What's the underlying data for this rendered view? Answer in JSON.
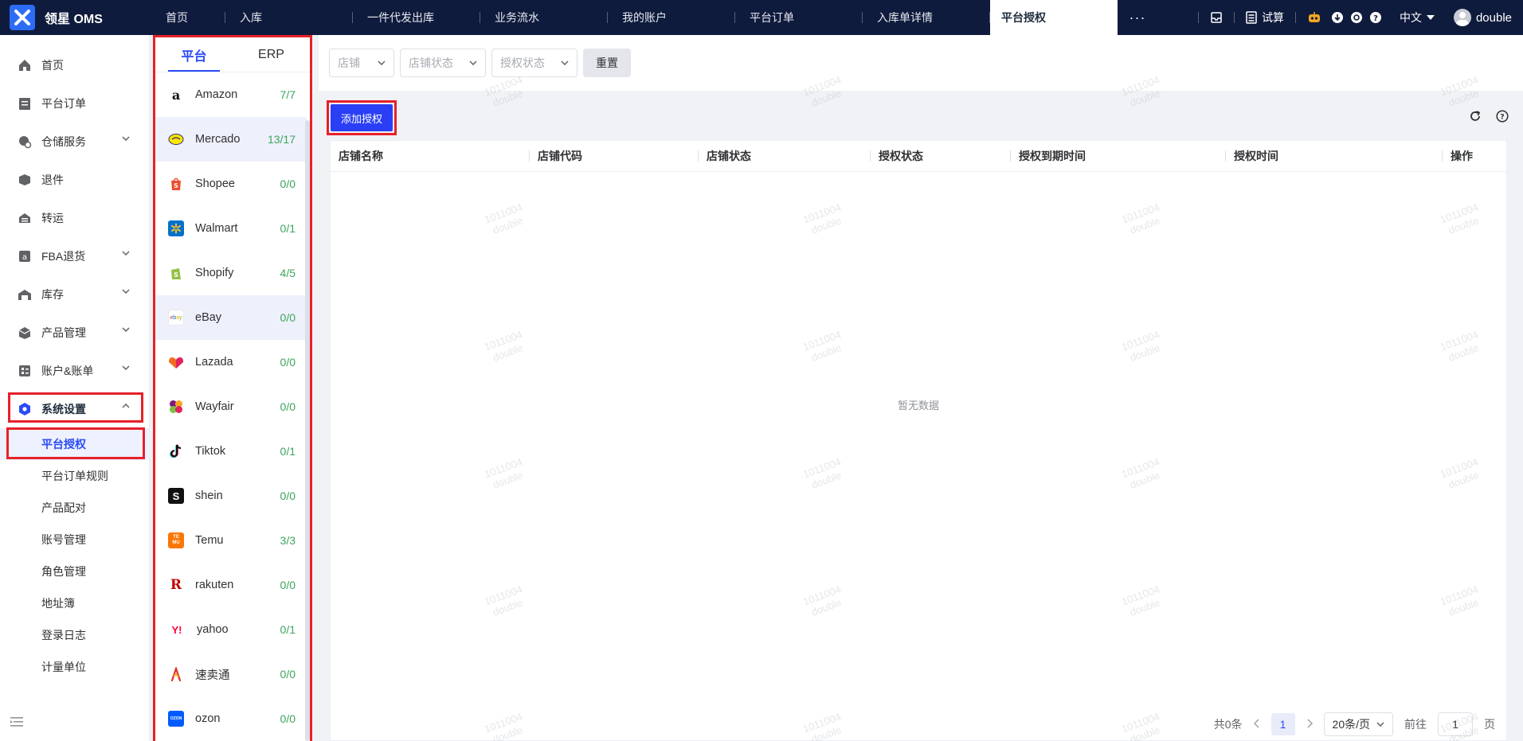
{
  "brand": {
    "name": "领星 OMS"
  },
  "topnav": {
    "tabs": [
      "首页",
      "入库",
      "一件代发出库",
      "业务流水",
      "我的账户",
      "平台订单",
      "入库单详情",
      "平台授权"
    ],
    "more": "···",
    "trial": "试算",
    "lang": "中文",
    "user": "double"
  },
  "sidebar": {
    "items": [
      {
        "label": "首页"
      },
      {
        "label": "平台订单"
      },
      {
        "label": "仓储服务"
      },
      {
        "label": "退件"
      },
      {
        "label": "转运"
      },
      {
        "label": "FBA退货"
      },
      {
        "label": "库存"
      },
      {
        "label": "产品管理"
      },
      {
        "label": "账户&账单"
      },
      {
        "label": "系统设置"
      }
    ],
    "subitems": [
      "平台授权",
      "平台订单规则",
      "产品配对",
      "账号管理",
      "角色管理",
      "地址簿",
      "登录日志",
      "计量单位"
    ]
  },
  "platform_panel": {
    "tabs": [
      "平台",
      "ERP"
    ],
    "items": [
      {
        "name": "Amazon",
        "count": "7/7"
      },
      {
        "name": "Mercado",
        "count": "13/17"
      },
      {
        "name": "Shopee",
        "count": "0/0"
      },
      {
        "name": "Walmart",
        "count": "0/1"
      },
      {
        "name": "Shopify",
        "count": "4/5"
      },
      {
        "name": "eBay",
        "count": "0/0"
      },
      {
        "name": "Lazada",
        "count": "0/0"
      },
      {
        "name": "Wayfair",
        "count": "0/0"
      },
      {
        "name": "Tiktok",
        "count": "0/1"
      },
      {
        "name": "shein",
        "count": "0/0"
      },
      {
        "name": "Temu",
        "count": "3/3"
      },
      {
        "name": "rakuten",
        "count": "0/0"
      },
      {
        "name": "yahoo",
        "count": "0/1"
      },
      {
        "name": "速卖通",
        "count": "0/0"
      },
      {
        "name": "ozon",
        "count": "0/0"
      }
    ]
  },
  "filters": {
    "shop_placeholder": "店铺",
    "shop_status_placeholder": "店铺状态",
    "auth_status_placeholder": "授权状态",
    "reset": "重置"
  },
  "actions": {
    "add_auth": "添加授权"
  },
  "table": {
    "columns": [
      "店铺名称",
      "店铺代码",
      "店铺状态",
      "授权状态",
      "授权到期时间",
      "授权时间",
      "操作"
    ],
    "empty": "暂无数据"
  },
  "pagination": {
    "total": "共0条",
    "current": "1",
    "page_size": "20条/页",
    "goto": "前往",
    "goto_value": "1",
    "page_unit": "页"
  },
  "watermark": {
    "line1": "1011004",
    "line2": "double"
  },
  "colors": {
    "topbar": "#0f1b3d",
    "primary": "#2a4bf5",
    "highlight": "#e6212a",
    "count": "#3ba55c"
  }
}
